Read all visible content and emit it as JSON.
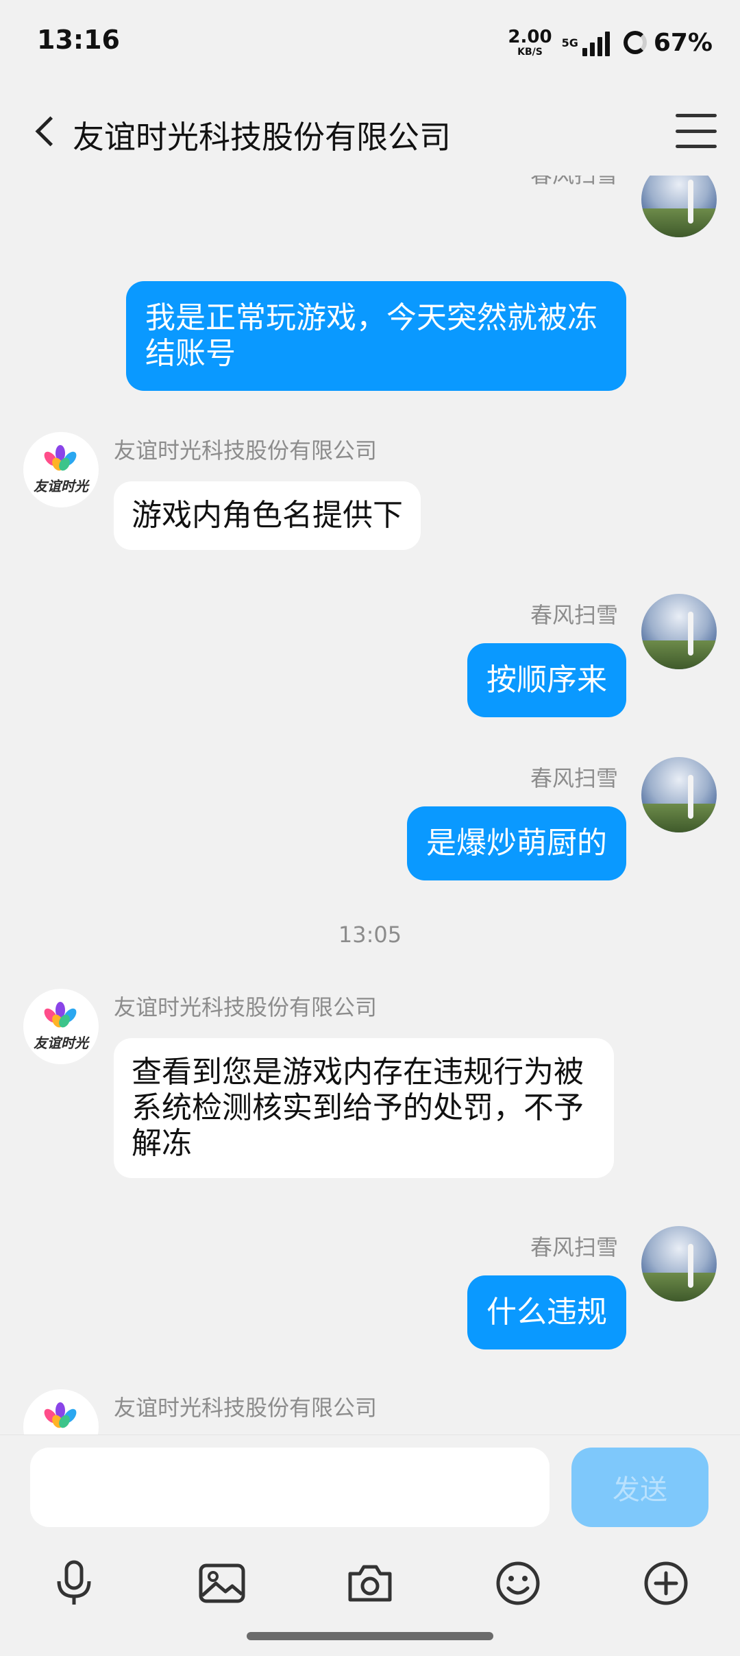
{
  "status_bar": {
    "time": "13:16",
    "net_speed_value": "2.00",
    "net_speed_unit": "KB/S",
    "network": "5G",
    "battery": "67%"
  },
  "header": {
    "title": "友谊时光科技股份有限公司"
  },
  "chat": {
    "contact_name": "友谊时光科技股份有限公司",
    "contact_logo_text": "友谊时光",
    "user_name": "春风扫雪",
    "time_separator": "13:05",
    "messages": [
      {
        "side": "out",
        "sender": "春风扫雪",
        "text": "我是正常玩游戏，今天突然就被冻结账号"
      },
      {
        "side": "in",
        "sender": "友谊时光科技股份有限公司",
        "text": "游戏内角色名提供下"
      },
      {
        "side": "out",
        "sender": "春风扫雪",
        "text": "按顺序来"
      },
      {
        "side": "out",
        "sender": "春风扫雪",
        "text": "是爆炒萌厨的"
      },
      {
        "side": "in",
        "sender": "友谊时光科技股份有限公司",
        "text": "查看到您是游戏内存在违规行为被系统检测核实到给予的处罚，不予解冻"
      },
      {
        "side": "out",
        "sender": "春风扫雪",
        "text": "什么违规"
      },
      {
        "side": "in",
        "sender": "友谊时光科技股份有限公司",
        "text": ""
      }
    ]
  },
  "composer": {
    "input_value": "",
    "send_label": "发送"
  },
  "toolbar_icons": [
    "microphone-icon",
    "image-icon",
    "camera-icon",
    "emoji-icon",
    "plus-icon"
  ],
  "colors": {
    "outgoing_bubble": "#0a99ff",
    "incoming_bubble": "#ffffff",
    "background": "#f1f1f1",
    "send_button_disabled": "#7ec8fb"
  }
}
